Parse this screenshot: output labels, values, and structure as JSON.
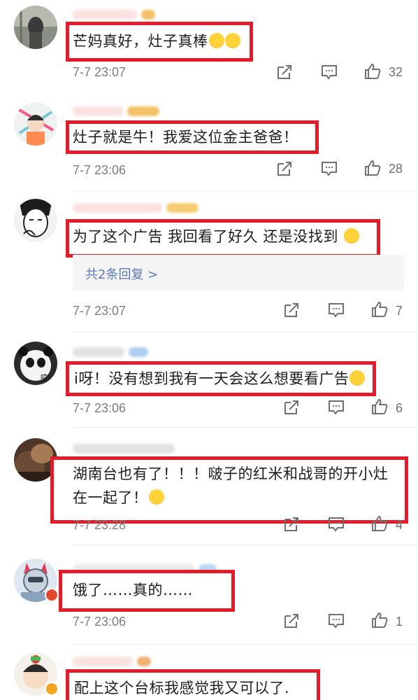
{
  "comments": [
    {
      "text": "芒妈真好，灶子真棒",
      "emoji": "crying-face-icon",
      "emoji_count": 2,
      "time": "7-7 23:07",
      "likes": "32"
    },
    {
      "text": "灶子就是牛！我爱这位金主爸爸！",
      "time": "7-7 23:06",
      "likes": "28"
    },
    {
      "text": "为了这个广告 我回看了好久 还是没找到",
      "emoji": "laughing-face-icon",
      "time": "7-7 23:07",
      "likes": "7",
      "replies": "共2条回复 >"
    },
    {
      "text": "i呀！没有想到我有一天会这么想要看广告",
      "emoji": "rolling-laugh-icon",
      "time": "7-7 23:06",
      "likes": "6"
    },
    {
      "text_line1": "湖南台也有了！！！啵子的红米和战哥的开小灶",
      "text_line2": "在一起了！",
      "emoji": "sunglasses-face-icon",
      "time": "7-7 23:28",
      "likes": "4"
    },
    {
      "text": "饿了……真的……",
      "time": "7-7 23:06",
      "likes": "1"
    },
    {
      "text": "配上这个台标我感觉我又可以了."
    }
  ],
  "avatar_labels": {
    "panda": "哎!"
  },
  "colors": {
    "highlight_box": "#e21c2a",
    "reply_link": "#5b7bb8",
    "meta_text": "#7c7c7c"
  }
}
